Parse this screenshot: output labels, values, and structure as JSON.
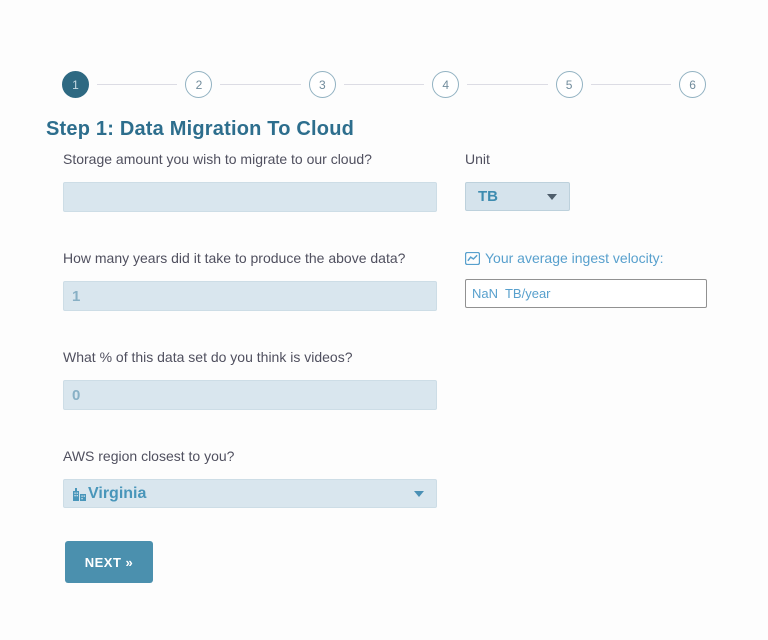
{
  "stepper": {
    "steps": [
      {
        "number": "1",
        "active": true
      },
      {
        "number": "2",
        "active": false
      },
      {
        "number": "3",
        "active": false
      },
      {
        "number": "4",
        "active": false
      },
      {
        "number": "5",
        "active": false
      },
      {
        "number": "6",
        "active": false
      }
    ]
  },
  "header": {
    "title": "Step 1: Data Migration To Cloud"
  },
  "form": {
    "storage": {
      "label": "Storage amount you wish to migrate to our cloud?",
      "value": ""
    },
    "unit": {
      "label": "Unit",
      "selected": "TB",
      "icon": "chevron-down-icon"
    },
    "years": {
      "label": "How many years did it take to produce the above data?",
      "value": "1"
    },
    "velocity": {
      "label": "Your average ingest velocity:",
      "value": "NaN  TB/year",
      "icon": "chart-line-icon"
    },
    "videos": {
      "label": "What % of this data set do you think is videos?",
      "value": "0"
    },
    "region": {
      "label": "AWS region closest to you?",
      "selected": "Virginia",
      "icon": "city-icon"
    },
    "next_button_label": "NEXT »"
  },
  "colors": {
    "accent_dark": "#2e6982",
    "title": "#2d6e8d",
    "input_bg": "#d9e6ee",
    "input_text": "#88b0c5",
    "link_blue": "#58a0cd",
    "button_bg": "#4b90ae"
  }
}
